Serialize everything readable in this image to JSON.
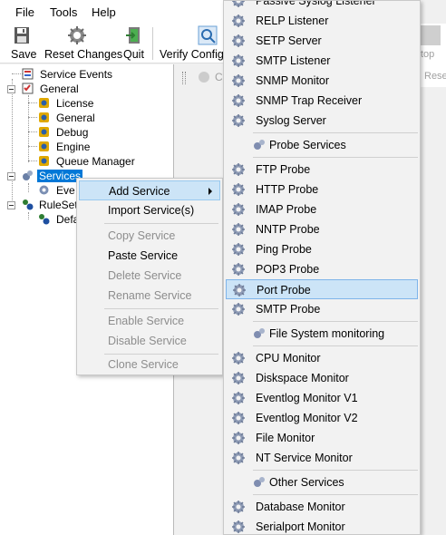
{
  "menubar": {
    "items": [
      "File",
      "Tools",
      "Help"
    ]
  },
  "toolbar": {
    "buttons": [
      {
        "label": "Save",
        "icon": "floppy-disk-icon"
      },
      {
        "label": "Reset Changes",
        "icon": "reset-gear-icon"
      },
      {
        "label": "Quit",
        "icon": "quit-door-icon"
      },
      {
        "label": "Verify Config",
        "icon": "magnifier-icon"
      }
    ]
  },
  "right_strip": {
    "text_top": "top",
    "text_bottom": "Rese"
  },
  "right_pane": {
    "hint": "C"
  },
  "tree": {
    "items": [
      {
        "label": "Service Events"
      },
      {
        "label": "General"
      },
      {
        "label": "License"
      },
      {
        "label": "General"
      },
      {
        "label": "Debug"
      },
      {
        "label": "Engine"
      },
      {
        "label": "Queue Manager"
      },
      {
        "label": "Services"
      },
      {
        "label": "Eve"
      },
      {
        "label": "RuleSet"
      },
      {
        "label": "Defa"
      }
    ]
  },
  "context_menu": {
    "items": [
      {
        "label": "Add Service",
        "enabled": true,
        "submenu": true
      },
      {
        "label": "Import Service(s)",
        "enabled": true
      },
      {
        "label": "Copy Service",
        "enabled": false
      },
      {
        "label": "Paste Service",
        "enabled": true
      },
      {
        "label": "Delete Service",
        "enabled": false
      },
      {
        "label": "Rename Service",
        "enabled": false
      },
      {
        "label": "Enable Service",
        "enabled": false
      },
      {
        "label": "Disable Service",
        "enabled": false
      },
      {
        "label": "Clone Service",
        "enabled": false
      }
    ]
  },
  "submenu": {
    "top_items": [
      "Passive Syslog Listener",
      "RELP Listener",
      "SETP Server",
      "SMTP Listener",
      "SNMP Monitor",
      "SNMP Trap Receiver",
      "Syslog Server"
    ],
    "probe_group": "Probe Services",
    "probe_items": [
      "FTP Probe",
      "HTTP Probe",
      "IMAP Probe",
      "NNTP Probe",
      "Ping Probe",
      "POP3 Probe",
      "Port Probe",
      "SMTP Probe"
    ],
    "fs_group": "File  System monitoring",
    "fs_items": [
      "CPU Monitor",
      "Diskspace Monitor",
      "Eventlog Monitor V1",
      "Eventlog Monitor V2",
      "File Monitor",
      "NT Service Monitor"
    ],
    "other_group": "Other Services",
    "other_items": [
      "Database Monitor",
      "Serialport Monitor"
    ],
    "highlighted": "Port Probe"
  },
  "colors": {
    "selection": "#0078d7",
    "menu_highlight": "#cce4f7"
  }
}
